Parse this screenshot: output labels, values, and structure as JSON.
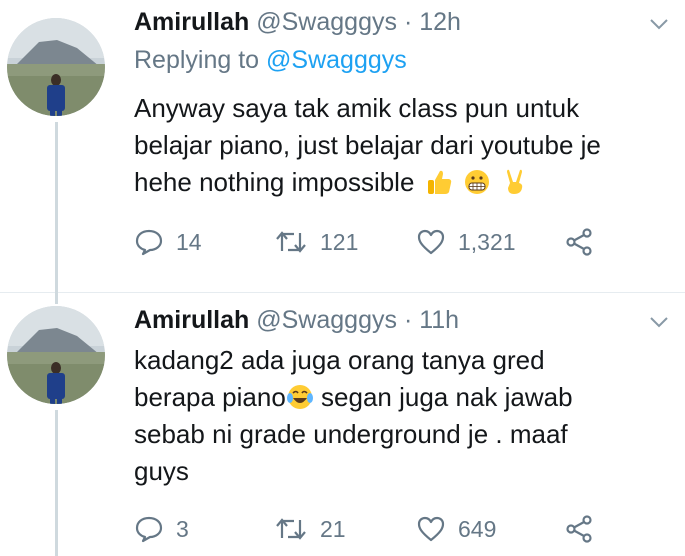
{
  "tweets": [
    {
      "display_name": "Amirullah",
      "handle": "@Swagggys",
      "time": "12h",
      "replying_prefix": "Replying to ",
      "replying_to": "@Swagggys",
      "text_lines": [
        "Anyway saya tak amik class pun untuk",
        "belajar piano, just belajar dari youtube je",
        "hehe nothing impossible"
      ],
      "emojis": [
        "thumbs-up-emoji",
        "grimacing-face-emoji",
        "victory-hand-emoji"
      ],
      "replies": "14",
      "retweets": "121",
      "likes": "1,321"
    },
    {
      "display_name": "Amirullah",
      "handle": "@Swagggys",
      "time": "11h",
      "text_line_1": "kadang2 ada juga orang tanya gred",
      "text_line_2a": "berapa piano",
      "text_line_2b": " segan juga nak jawab",
      "text_line_3": "sebab ni grade underground je . maaf",
      "text_line_4": "guys",
      "emoji": "crying-laughing-emoji",
      "replies": "3",
      "retweets": "21",
      "likes": "649"
    }
  ],
  "colors": {
    "text": "#14171a",
    "muted": "#657786",
    "link": "#1da1f2",
    "divider": "#e6ecf0",
    "thread_line": "#cfd9de"
  },
  "icons": [
    "chevron-down-icon",
    "reply-icon",
    "retweet-icon",
    "like-icon",
    "share-icon"
  ]
}
